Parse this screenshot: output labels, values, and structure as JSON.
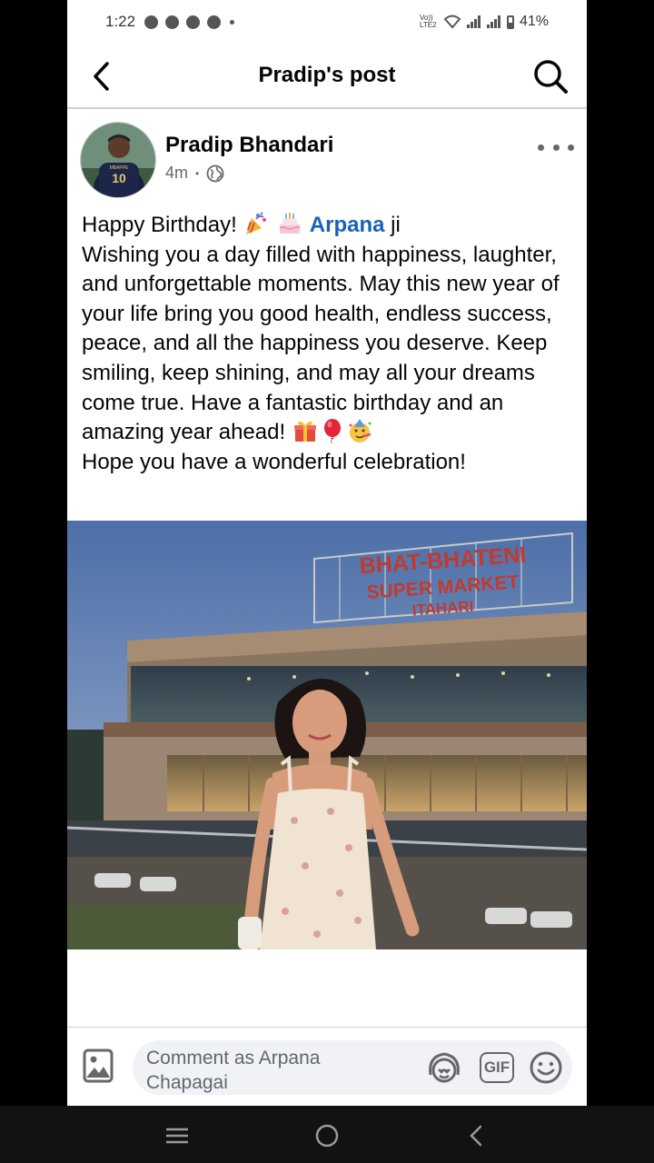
{
  "status_bar": {
    "time": "1:22",
    "battery": "41%",
    "network_label": "Vo)) LTE2"
  },
  "header": {
    "title": "Pradip's post"
  },
  "post": {
    "author": "Pradip Bhandari",
    "time_ago": "4m",
    "separator": "•",
    "avatar_jersey_number": "10",
    "avatar_jersey_name": "MBAPPE",
    "text": {
      "greeting": "Happy Birthday!",
      "mention": "Arpana",
      "mention_suffix": "ji",
      "body": "Wishing you a day filled with happiness, laughter, and unforgettable moments. May this new year of your life bring you good health, endless success, peace, and all the happiness you deserve. Keep smiling, keep shining, and may all your dreams come true. Have a fantastic birthday and an amazing year ahead!",
      "closing": "Hope you have a wonderful celebration!"
    },
    "photo": {
      "sign_line1": "BHAT-BHATENI",
      "sign_line2": "SUPER MARKET",
      "sign_line3": "ITAHARI"
    }
  },
  "composer": {
    "placeholder": "Comment as Arpana Chapagai",
    "gif_label": "GIF"
  },
  "icons": {
    "back": "back-arrow-icon",
    "search": "search-icon",
    "more": "more-dots-icon",
    "privacy": "globe-icon",
    "photo": "photo-icon",
    "avatar_sticker": "avatar-sticker-icon",
    "emoji": "emoji-icon",
    "nav_recents": "recents-icon",
    "nav_home": "home-icon",
    "nav_back": "nav-back-icon"
  },
  "colors": {
    "mention": "#1b61b8",
    "text": "#050505",
    "meta": "#65676b",
    "sign_red": "#c23a2e"
  }
}
